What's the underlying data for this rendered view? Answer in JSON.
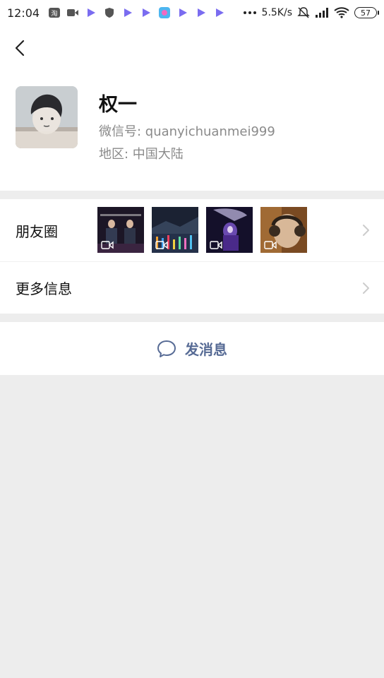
{
  "status_bar": {
    "time": "12:04",
    "speed": "5.5K/s",
    "battery": "57",
    "icons": [
      "app-notification-icon",
      "video-call-icon",
      "play-icon",
      "shield-icon",
      "play-icon",
      "play-icon",
      "app-icon",
      "play-icon",
      "play-icon",
      "play-icon",
      "more-dots-icon",
      "mute-icon",
      "signal-icon",
      "wifi-icon",
      "battery-icon"
    ]
  },
  "profile": {
    "name": "权一",
    "wechat_id": "微信号: quanyichuanmei999",
    "region": "地区: 中国大陆"
  },
  "moments": {
    "label": "朋友圈",
    "thumbnails": [
      {
        "type": "video",
        "icon": "video-icon",
        "color": "#2a1d3d"
      },
      {
        "type": "video",
        "icon": "video-icon",
        "color": "#27324a"
      },
      {
        "type": "video",
        "icon": "video-icon",
        "color": "#3a1a5a"
      },
      {
        "type": "video",
        "icon": "video-icon",
        "color": "#7a4a22"
      }
    ]
  },
  "more_info": {
    "label": "更多信息"
  },
  "send_message": {
    "label": "发消息",
    "color": "#576b95"
  }
}
